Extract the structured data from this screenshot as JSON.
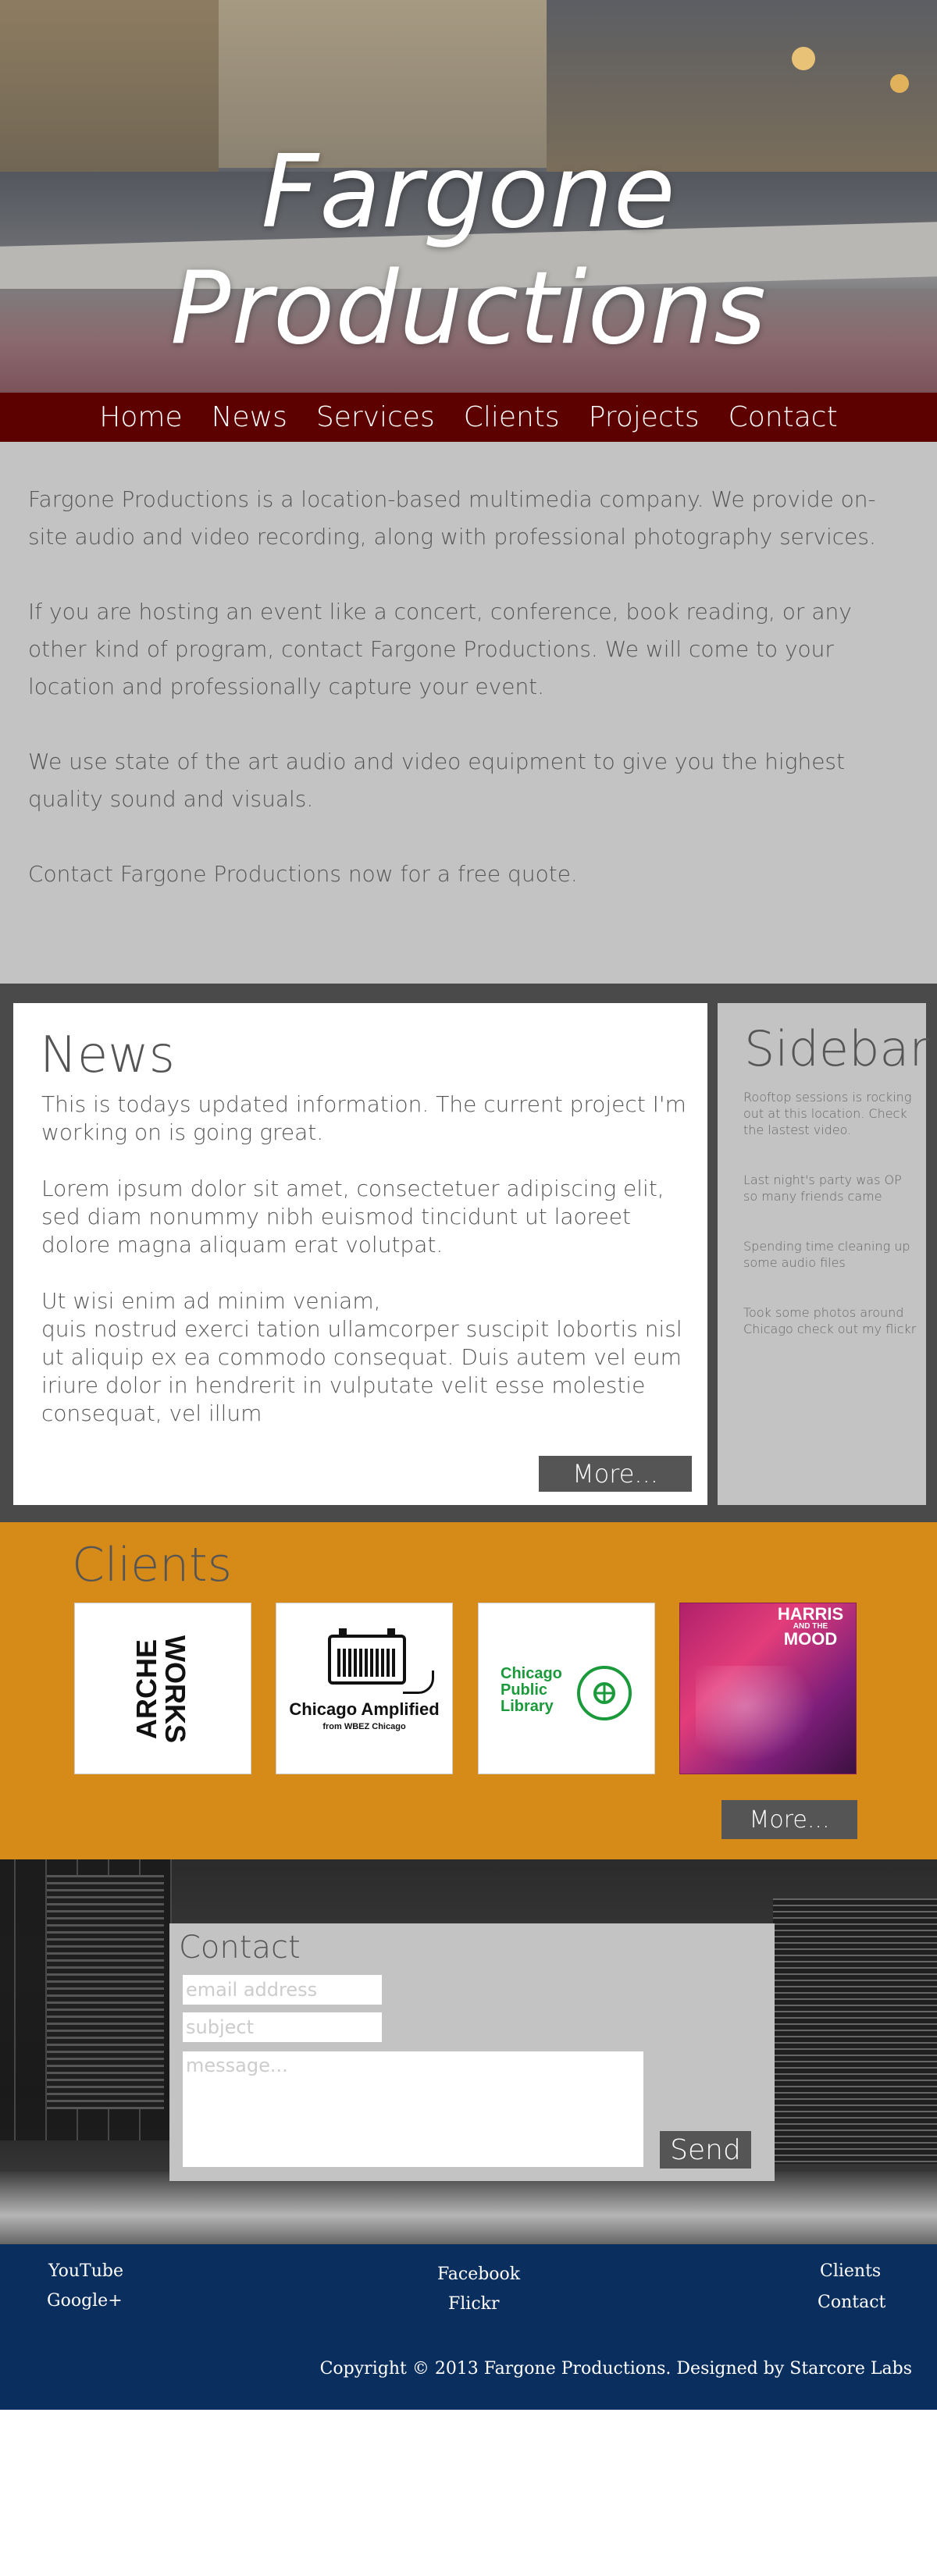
{
  "hero": {
    "title": "Fargone Productions"
  },
  "nav": [
    "Home",
    "News",
    "Services",
    "Clients",
    "Projects",
    "Contact"
  ],
  "intro": [
    "Fargone Productions is a location-based multimedia company. We provide on-site audio and video recording, along with professional photography services.",
    "If you are hosting an event like a concert, conference, book reading, or any other kind of program, contact Fargone Productions. We will come to your location and professionally capture your event.",
    "We use state of the art audio and video equipment to give you the highest quality sound and visuals.",
    "Contact Fargone Productions now for a free quote."
  ],
  "news": {
    "title": "News",
    "paragraphs": [
      "This is todays updated information. The current project I'm working on is going great.",
      "Lorem ipsum dolor sit amet, consectetuer adipiscing elit, sed diam nonummy nibh euismod tincidunt ut laoreet dolore magna aliquam erat volutpat.",
      "Ut wisi enim ad minim veniam,\nquis nostrud exerci tation ullamcorper suscipit lobortis nisl ut aliquip ex ea commodo consequat. Duis autem vel eum iriure dolor in hendrerit in vulputate velit esse molestie consequat, vel illum"
    ],
    "more": "More..."
  },
  "sidebar": {
    "title": "Sidebar",
    "items": [
      "Rooftop sessions is rocking out at this location. Check the lastest video.",
      "Last night's party was OP so many friends came",
      "Spending time cleaning up some audio files",
      "Took some photos around Chicago check out my flickr"
    ]
  },
  "clients": {
    "title": "Clients",
    "logos": [
      {
        "name": "ARCHE WORKS",
        "line1": "ARCHE",
        "line2": "WORKS"
      },
      {
        "name": "Chicago Amplified",
        "sub": "from WBEZ Chicago"
      },
      {
        "name": "Chicago Public Library",
        "lines": [
          "Chicago",
          "Public",
          "Library"
        ],
        "seal": "CHICAGO PUBLIC LIBRARY"
      },
      {
        "name": "Harris and the Mood",
        "line1": "HARRIS",
        "line2": "AND THE",
        "line3": "MOOD"
      }
    ],
    "more": "More..."
  },
  "contact": {
    "title": "Contact",
    "email_placeholder": "email address",
    "subject_placeholder": "subject",
    "message_placeholder": "message...",
    "send": "Send"
  },
  "footer": {
    "left": [
      "YouTube",
      "Google+"
    ],
    "center": [
      "Facebook",
      "Flickr"
    ],
    "right": [
      "Clients",
      "Contact"
    ],
    "copyright": "Copyright © 2013 Fargone Productions. Designed by Starcore Labs"
  },
  "colors": {
    "nav": "#5c0000",
    "intro_bg": "#c3c3c3",
    "band_bg": "#4a4a4a",
    "clients_bg": "#d68a18",
    "footer_bg": "#0a2e5e",
    "button": "#555555"
  }
}
